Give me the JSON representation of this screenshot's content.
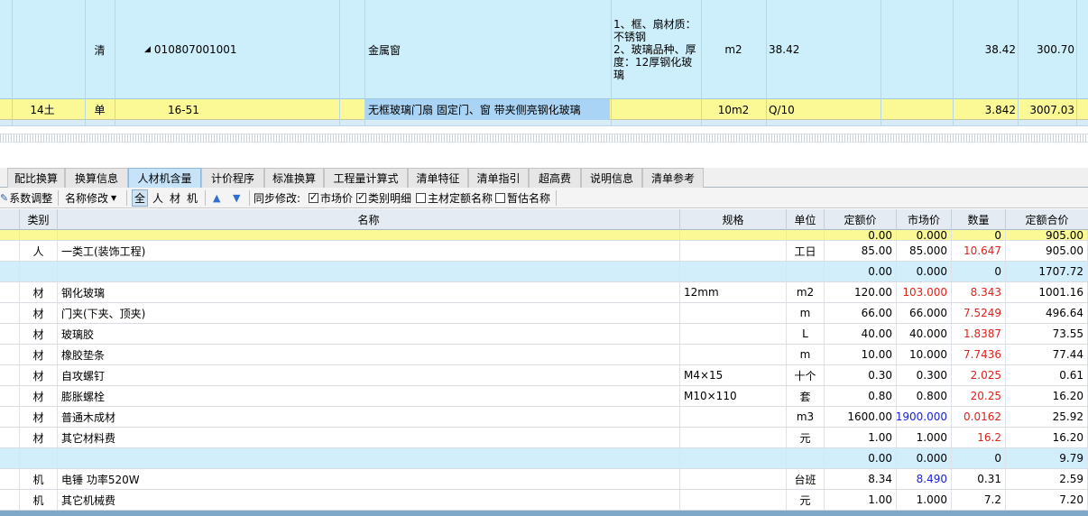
{
  "upper": {
    "row1": {
      "type": "清",
      "code": "010807001001",
      "name": "金属窗",
      "feature": "1、框、扇材质：不锈钢\n2、玻璃品种、厚度：12厚钢化玻璃",
      "unit": "m2",
      "qty_expr": "38.42",
      "qty": "38.42",
      "price": "300.70"
    },
    "row2": {
      "seq": "14土",
      "type": "单",
      "code": "16-51",
      "name": "无框玻璃门扇 固定门、窗 带夹侧亮钢化玻璃",
      "unit": "10m2",
      "qty_expr": "Q/10",
      "qty": "3.842",
      "price": "3007.03"
    }
  },
  "tabs": [
    {
      "label": "配比换算"
    },
    {
      "label": "换算信息"
    },
    {
      "label": "人材机含量"
    },
    {
      "label": "计价程序"
    },
    {
      "label": "标准换算"
    },
    {
      "label": "工程量计算式"
    },
    {
      "label": "清单特征"
    },
    {
      "label": "清单指引"
    },
    {
      "label": "超高费"
    },
    {
      "label": "说明信息"
    },
    {
      "label": "清单参考"
    }
  ],
  "toolbar": {
    "coef_adjust": "系数调整",
    "rename": "名称修改",
    "filter_all": "全",
    "filter_labor": "人",
    "filter_material": "材",
    "filter_machine": "机",
    "sync_label": "同步修改:",
    "opt_market": "市场价",
    "opt_category": "类别明细",
    "opt_main_quota": "主材定额名称",
    "opt_estimate": "暂估名称"
  },
  "columns": {
    "category": "类别",
    "name": "名称",
    "spec": "规格",
    "unit": "单位",
    "quota_price": "定额价",
    "market_price": "市场价",
    "quantity": "数量",
    "quota_total": "定额合价"
  },
  "rows": [
    {
      "category": "",
      "name": "",
      "spec": "",
      "unit": "",
      "quota_price": "0.00",
      "market_price": "0.000",
      "quantity": "0",
      "quota_total": "905.00",
      "style": "yellow",
      "partial": true
    },
    {
      "category": "人",
      "name": "一类工(装饰工程)",
      "spec": "",
      "unit": "工日",
      "quota_price": "85.00",
      "market_price": "85.000",
      "quantity": "10.647",
      "quota_total": "905.00",
      "qcolor": "red"
    },
    {
      "category": "",
      "name": "",
      "spec": "",
      "unit": "",
      "quota_price": "0.00",
      "market_price": "0.000",
      "quantity": "0",
      "quota_total": "1707.72",
      "style": "blue"
    },
    {
      "category": "材",
      "name": "钢化玻璃",
      "spec": "12mm",
      "unit": "m2",
      "quota_price": "120.00",
      "market_price": "103.000",
      "quantity": "8.343",
      "quota_total": "1001.16",
      "mcolor": "red",
      "qcolor": "red"
    },
    {
      "category": "材",
      "name": "门夹(下夹、顶夹)",
      "spec": "",
      "unit": "m",
      "quota_price": "66.00",
      "market_price": "66.000",
      "quantity": "7.5249",
      "quota_total": "496.64",
      "qcolor": "red"
    },
    {
      "category": "材",
      "name": "玻璃胶",
      "spec": "",
      "unit": "L",
      "quota_price": "40.00",
      "market_price": "40.000",
      "quantity": "1.8387",
      "quota_total": "73.55",
      "qcolor": "red"
    },
    {
      "category": "材",
      "name": "橡胶垫条",
      "spec": "",
      "unit": "m",
      "quota_price": "10.00",
      "market_price": "10.000",
      "quantity": "7.7436",
      "quota_total": "77.44",
      "qcolor": "red"
    },
    {
      "category": "材",
      "name": "自攻螺钉",
      "spec": "M4×15",
      "unit": "十个",
      "quota_price": "0.30",
      "market_price": "0.300",
      "quantity": "2.025",
      "quota_total": "0.61",
      "qcolor": "red"
    },
    {
      "category": "材",
      "name": "膨胀螺栓",
      "spec": "M10×110",
      "unit": "套",
      "quota_price": "0.80",
      "market_price": "0.800",
      "quantity": "20.25",
      "quota_total": "16.20",
      "qcolor": "red"
    },
    {
      "category": "材",
      "name": "普通木成材",
      "spec": "",
      "unit": "m3",
      "quota_price": "1600.00",
      "market_price": "1900.000",
      "quantity": "0.0162",
      "quota_total": "25.92",
      "mcolor": "blue",
      "qcolor": "red"
    },
    {
      "category": "材",
      "name": "其它材料费",
      "spec": "",
      "unit": "元",
      "quota_price": "1.00",
      "market_price": "1.000",
      "quantity": "16.2",
      "quota_total": "16.20",
      "qcolor": "red"
    },
    {
      "category": "",
      "name": "",
      "spec": "",
      "unit": "",
      "quota_price": "0.00",
      "market_price": "0.000",
      "quantity": "0",
      "quota_total": "9.79",
      "style": "blue"
    },
    {
      "category": "机",
      "name": "电锤 功率520W",
      "spec": "",
      "unit": "台班",
      "quota_price": "8.34",
      "market_price": "8.490",
      "quantity": "0.31",
      "quota_total": "2.59",
      "mcolor": "blue"
    },
    {
      "category": "机",
      "name": "其它机械费",
      "spec": "",
      "unit": "元",
      "quota_price": "1.00",
      "market_price": "1.000",
      "quantity": "7.2",
      "quota_total": "7.20"
    }
  ]
}
